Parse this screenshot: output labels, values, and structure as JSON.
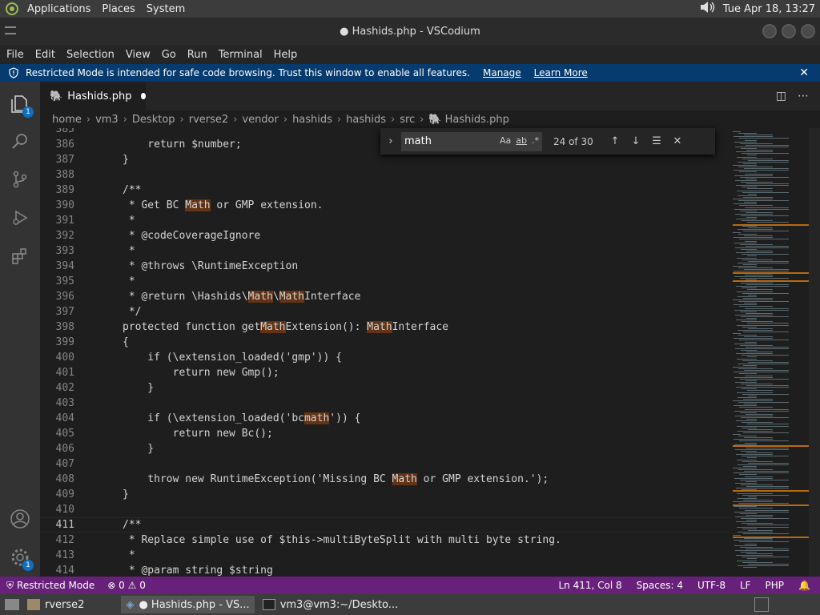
{
  "top_panel": {
    "menus": [
      "Applications",
      "Places",
      "System"
    ],
    "clock": "Tue Apr 18, 13:27"
  },
  "window": {
    "title": "● Hashids.php - VSCodium"
  },
  "menubar": [
    "File",
    "Edit",
    "Selection",
    "View",
    "Go",
    "Run",
    "Terminal",
    "Help"
  ],
  "banner": {
    "text": "Restricted Mode is intended for safe code browsing. Trust this window to enable all features.",
    "manage": "Manage",
    "learn_more": "Learn More"
  },
  "activity": {
    "explorer_badge": "1",
    "settings_badge": "1"
  },
  "tab": {
    "label": "Hashids.php"
  },
  "breadcrumb": [
    "home",
    "vm3",
    "Desktop",
    "rverse2",
    "vendor",
    "hashids",
    "hashids",
    "src",
    "Hashids.php"
  ],
  "find": {
    "query": "math",
    "opt_case": "Aa",
    "opt_word": "ab",
    "opt_regex": ".*",
    "count": "24 of 30"
  },
  "lines": [
    {
      "n": "385",
      "t": ""
    },
    {
      "n": "386",
      "t": "    return $number;"
    },
    {
      "n": "387",
      "t": "}"
    },
    {
      "n": "388",
      "t": ""
    },
    {
      "n": "389",
      "t": "/**"
    },
    {
      "n": "390",
      "t": " * Get BC Math or GMP extension."
    },
    {
      "n": "391",
      "t": " *"
    },
    {
      "n": "392",
      "t": " * @codeCoverageIgnore"
    },
    {
      "n": "393",
      "t": " *"
    },
    {
      "n": "394",
      "t": " * @throws \\RuntimeException"
    },
    {
      "n": "395",
      "t": " *"
    },
    {
      "n": "396",
      "t": " * @return \\Hashids\\Math\\MathInterface"
    },
    {
      "n": "397",
      "t": " */"
    },
    {
      "n": "398",
      "t": "protected function getMathExtension(): MathInterface"
    },
    {
      "n": "399",
      "t": "{"
    },
    {
      "n": "400",
      "t": "    if (\\extension_loaded('gmp')) {"
    },
    {
      "n": "401",
      "t": "        return new Gmp();"
    },
    {
      "n": "402",
      "t": "    }"
    },
    {
      "n": "403",
      "t": ""
    },
    {
      "n": "404",
      "t": "    if (\\extension_loaded('bcmath')) {"
    },
    {
      "n": "405",
      "t": "        return new Bc();"
    },
    {
      "n": "406",
      "t": "    }"
    },
    {
      "n": "407",
      "t": ""
    },
    {
      "n": "408",
      "t": "    throw new RuntimeException('Missing BC Math or GMP extension.');"
    },
    {
      "n": "409",
      "t": "}"
    },
    {
      "n": "410",
      "t": ""
    },
    {
      "n": "411",
      "t": "/**"
    },
    {
      "n": "412",
      "t": " * Replace simple use of $this->multiByteSplit with multi byte string."
    },
    {
      "n": "413",
      "t": " *"
    },
    {
      "n": "414",
      "t": " * @param string $string"
    }
  ],
  "status": {
    "mode": "Restricted Mode",
    "errors": "0",
    "warnings": "0",
    "position": "Ln 411, Col 8",
    "spaces": "Spaces: 4",
    "encoding": "UTF-8",
    "eol": "LF",
    "language": "PHP"
  },
  "taskbar": {
    "items": [
      "rverse2",
      "● Hashids.php - VS...",
      "vm3@vm3:~/Deskto..."
    ]
  }
}
